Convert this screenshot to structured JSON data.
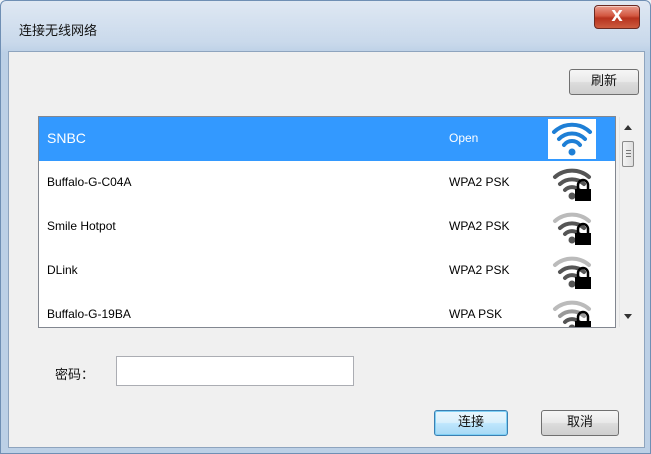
{
  "window": {
    "title": "连接无线网络",
    "close_label": "X"
  },
  "toolbar": {
    "refresh_label": "刷新"
  },
  "networks": [
    {
      "name": "SNBC",
      "security": "Open",
      "locked": false,
      "selected": true,
      "icon": "wifi-signal-icon"
    },
    {
      "name": "Buffalo-G-C04A",
      "security": "WPA2 PSK",
      "locked": true,
      "selected": false,
      "icon": "wifi-locked-icon"
    },
    {
      "name": "Smile Hotpot",
      "security": "WPA2 PSK",
      "locked": true,
      "selected": false,
      "icon": "wifi-locked-icon"
    },
    {
      "name": "DLink",
      "security": "WPA2 PSK",
      "locked": true,
      "selected": false,
      "icon": "wifi-locked-icon"
    },
    {
      "name": "Buffalo-G-19BA",
      "security": "WPA PSK",
      "locked": true,
      "selected": false,
      "icon": "wifi-locked-icon"
    }
  ],
  "password": {
    "label": "密码：",
    "value": "",
    "placeholder": ""
  },
  "actions": {
    "connect_label": "连接",
    "cancel_label": "取消"
  },
  "colors": {
    "selection": "#3399ff",
    "wifi_open": "#1e7fd6",
    "wifi_locked": "#555555"
  }
}
